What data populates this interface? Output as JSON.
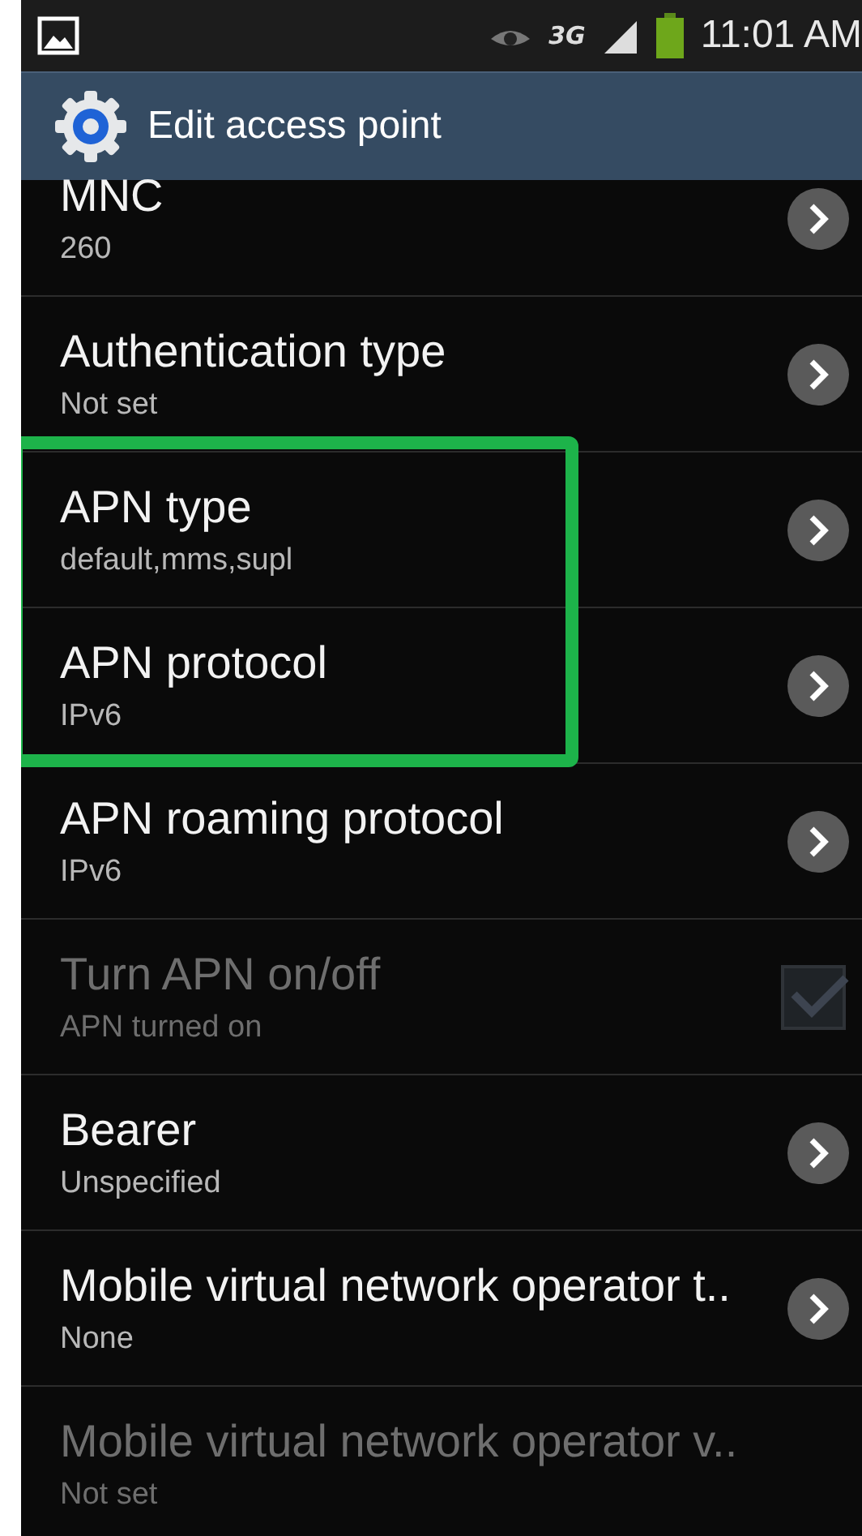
{
  "status_bar": {
    "time": "11:01 AM",
    "network": "3G"
  },
  "action_bar": {
    "title": "Edit access point"
  },
  "settings": [
    {
      "title": "MNC",
      "summary": "260",
      "kind": "chevron",
      "disabled": false,
      "highlighted": false
    },
    {
      "title": "Authentication type",
      "summary": "Not set",
      "kind": "chevron",
      "disabled": false,
      "highlighted": false
    },
    {
      "title": "APN type",
      "summary": "default,mms,supl",
      "kind": "chevron",
      "disabled": false,
      "highlighted": true
    },
    {
      "title": "APN protocol",
      "summary": "IPv6",
      "kind": "chevron",
      "disabled": false,
      "highlighted": true
    },
    {
      "title": "APN roaming protocol",
      "summary": "IPv6",
      "kind": "chevron",
      "disabled": false,
      "highlighted": false
    },
    {
      "title": "Turn APN on/off",
      "summary": "APN turned on",
      "kind": "checkbox",
      "checked": true,
      "disabled": true,
      "highlighted": false
    },
    {
      "title": "Bearer",
      "summary": "Unspecified",
      "kind": "chevron",
      "disabled": false,
      "highlighted": false
    },
    {
      "title": "Mobile virtual network operator t..",
      "summary": "None",
      "kind": "chevron",
      "disabled": false,
      "highlighted": false
    },
    {
      "title": "Mobile virtual network operator v..",
      "summary": "Not set",
      "kind": "none",
      "disabled": true,
      "highlighted": false
    }
  ]
}
